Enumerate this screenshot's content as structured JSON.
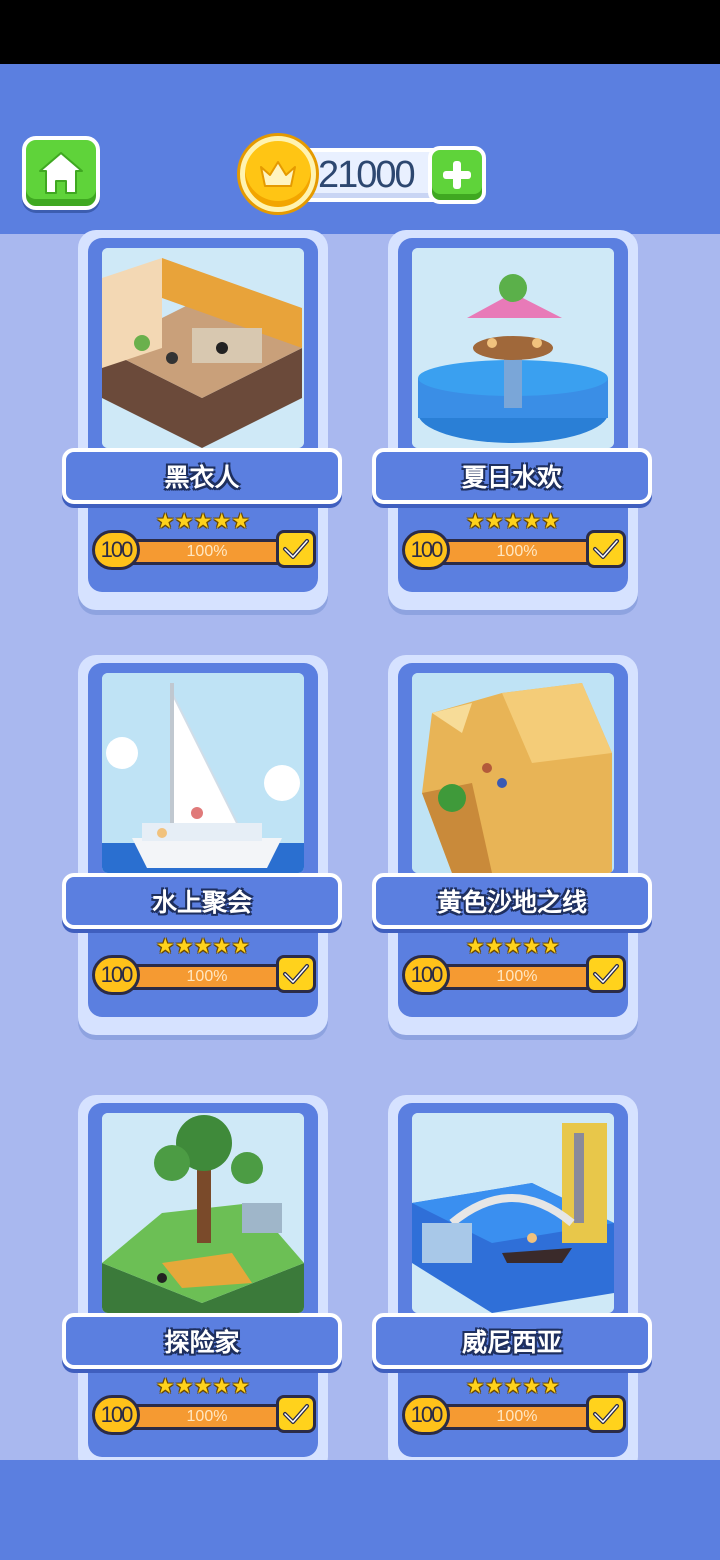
{
  "header": {
    "coins": "21000",
    "home_icon": "home-icon",
    "coin_icon": "crown-coin-icon",
    "add_icon": "plus-icon"
  },
  "colors": {
    "accent_blue": "#5b7fe0",
    "background": "#a9b8ef",
    "button_green": "#5fd33a",
    "progress_orange": "#f59a32",
    "star_yellow": "#ffd21c"
  },
  "levels": [
    {
      "title": "黑衣人",
      "stars": "★★★★★",
      "star_count": 5,
      "pieces": "100",
      "progress_text": "100%",
      "progress": 1.0,
      "completed": true
    },
    {
      "title": "夏日水欢",
      "stars": "★★★★★",
      "star_count": 5,
      "pieces": "100",
      "progress_text": "100%",
      "progress": 1.0,
      "completed": true
    },
    {
      "title": "水上聚会",
      "stars": "★★★★★",
      "star_count": 5,
      "pieces": "100",
      "progress_text": "100%",
      "progress": 1.0,
      "completed": true
    },
    {
      "title": "黄色沙地之线",
      "stars": "★★★★★",
      "star_count": 5,
      "pieces": "100",
      "progress_text": "100%",
      "progress": 1.0,
      "completed": true
    },
    {
      "title": "探险家",
      "stars": "★★★★★",
      "star_count": 5,
      "pieces": "100",
      "progress_text": "100%",
      "progress": 1.0,
      "completed": true
    },
    {
      "title": "威尼西亚",
      "stars": "★★★★★",
      "star_count": 5,
      "pieces": "100",
      "progress_text": "100%",
      "progress": 1.0,
      "completed": true
    }
  ]
}
